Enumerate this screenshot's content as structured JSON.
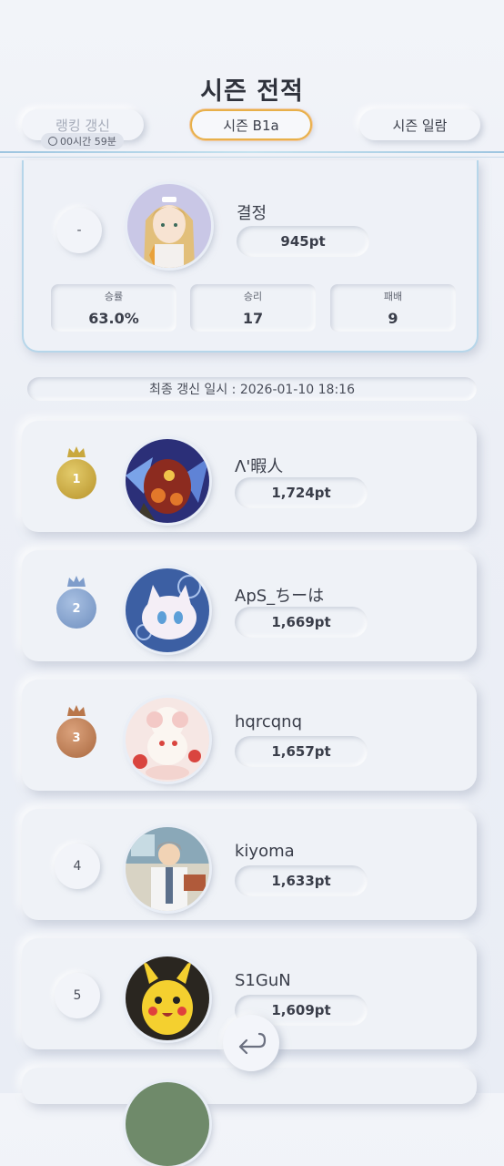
{
  "header": {
    "title": "시즌 전적"
  },
  "tabs": {
    "refresh_label": "랭킹 갱신",
    "refresh_timer": "00시간 59분",
    "season_label": "시즌 B1a",
    "list_label": "시즌 일람"
  },
  "my_record": {
    "rank": "-",
    "name": "결정",
    "points": "945pt",
    "stats": [
      {
        "label": "승률",
        "value": "63.0%"
      },
      {
        "label": "승리",
        "value": "17"
      },
      {
        "label": "패배",
        "value": "9"
      }
    ]
  },
  "updated_text": "최종 갱신 일시 : 2026-01-10 18:16",
  "rankings": [
    {
      "rank": "1",
      "name": "Λ'暇人",
      "points": "1,724pt"
    },
    {
      "rank": "2",
      "name": "ApS_ちーは",
      "points": "1,669pt"
    },
    {
      "rank": "3",
      "name": "hqrcqnq",
      "points": "1,657pt"
    },
    {
      "rank": "4",
      "name": "kiyoma",
      "points": "1,633pt"
    },
    {
      "rank": "5",
      "name": "S1GuN",
      "points": "1,609pt"
    }
  ],
  "icons": {
    "back": "return-arrow-icon",
    "clock": "clock-icon",
    "crown": "crown-icon"
  },
  "colors": {
    "accent_border": "#e8b04a",
    "gold": "#c9a83e",
    "silver": "#7f9dcb",
    "bronze": "#b9774b"
  }
}
